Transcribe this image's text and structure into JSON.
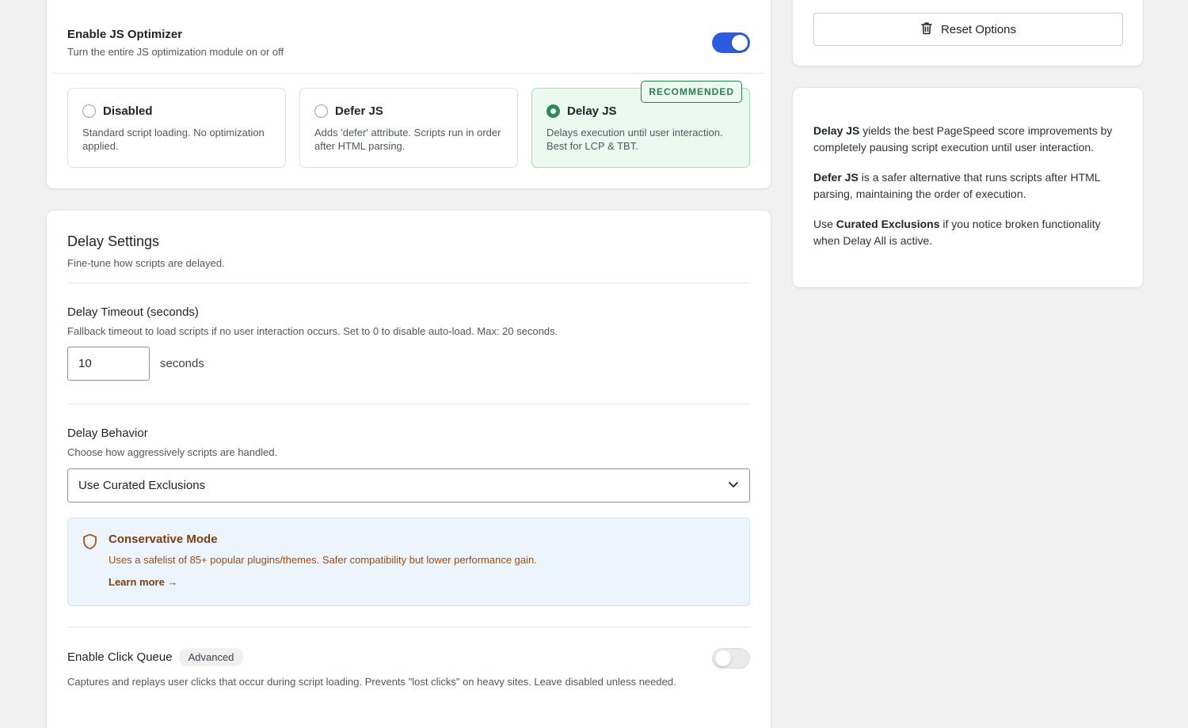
{
  "optimizer": {
    "title": "Enable JS Optimizer",
    "subtitle": "Turn the entire JS optimization module on or off",
    "enabled": true,
    "options": [
      {
        "name": "Disabled",
        "desc": "Standard script loading. No optimization applied.",
        "selected": false
      },
      {
        "name": "Defer JS",
        "desc": "Adds 'defer' attribute. Scripts run in order after HTML parsing.",
        "selected": false
      },
      {
        "name": "Delay JS",
        "desc": "Delays execution until user interaction. Best for LCP & TBT.",
        "selected": true,
        "badge": "RECOMMENDED"
      }
    ]
  },
  "delay_settings": {
    "title": "Delay Settings",
    "subtitle": "Fine-tune how scripts are delayed.",
    "timeout": {
      "label": "Delay Timeout (seconds)",
      "help": "Fallback timeout to load scripts if no user interaction occurs. Set to 0 to disable auto-load. Max: 20 seconds.",
      "value": "10",
      "unit": "seconds"
    },
    "behavior": {
      "label": "Delay Behavior",
      "help": "Choose how aggressively scripts are handled.",
      "selected": "Use Curated Exclusions"
    },
    "mode_box": {
      "title": "Conservative Mode",
      "text": "Uses a safelist of 85+ popular plugins/themes. Safer compatibility but lower performance gain.",
      "link": "Learn more →"
    },
    "click_queue": {
      "label": "Enable Click Queue",
      "badge": "Advanced",
      "help": "Captures and replays user clicks that occur during script loading. Prevents \"lost clicks\" on heavy sites. Leave disabled unless needed.",
      "enabled": false
    }
  },
  "sidebar": {
    "reset_label": "Reset Options",
    "help": {
      "p1_bold": "Delay JS",
      "p1_text": " yields the best PageSpeed score improvements by completely pausing script execution until user interaction.",
      "p2_bold": "Defer JS",
      "p2_text": " is a safer alternative that runs scripts after HTML parsing, maintaining the order of execution.",
      "p3_pre": "Use ",
      "p3_bold": "Curated Exclusions",
      "p3_text": " if you notice broken functionality when Delay All is active."
    }
  },
  "icons": {
    "reset": "trash-icon",
    "mode": "shield-icon",
    "select": "chevron-down-icon"
  },
  "colors": {
    "accent": "#2c5be0",
    "success": "#2e8b57",
    "warning_text": "#a04b0c"
  }
}
